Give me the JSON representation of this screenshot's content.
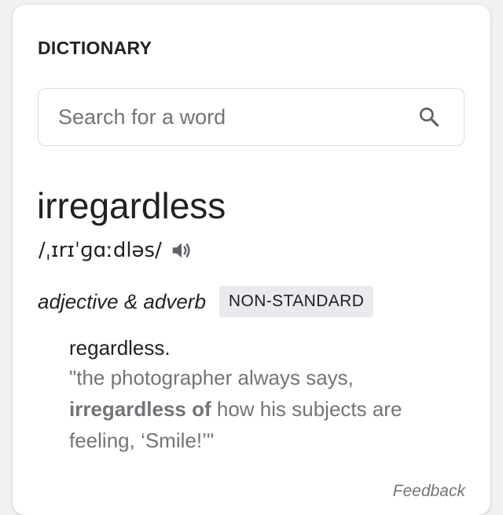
{
  "widget": {
    "header": "DICTIONARY",
    "search": {
      "placeholder": "Search for a word",
      "icon": "search-icon"
    }
  },
  "entry": {
    "word": "irregardless",
    "phonetic": "/ˌɪrɪˈɡɑːdləs/",
    "audio_icon": "speaker-icon",
    "part_of_speech": "adjective & adverb",
    "label": "NON-STANDARD",
    "definition": "regardless.",
    "example": {
      "before": "\"the photographer always says, ",
      "bold": "irregardless of",
      "after": " how his subjects are feeling, ‘Smile!’\""
    }
  },
  "footer": {
    "feedback": "Feedback"
  }
}
